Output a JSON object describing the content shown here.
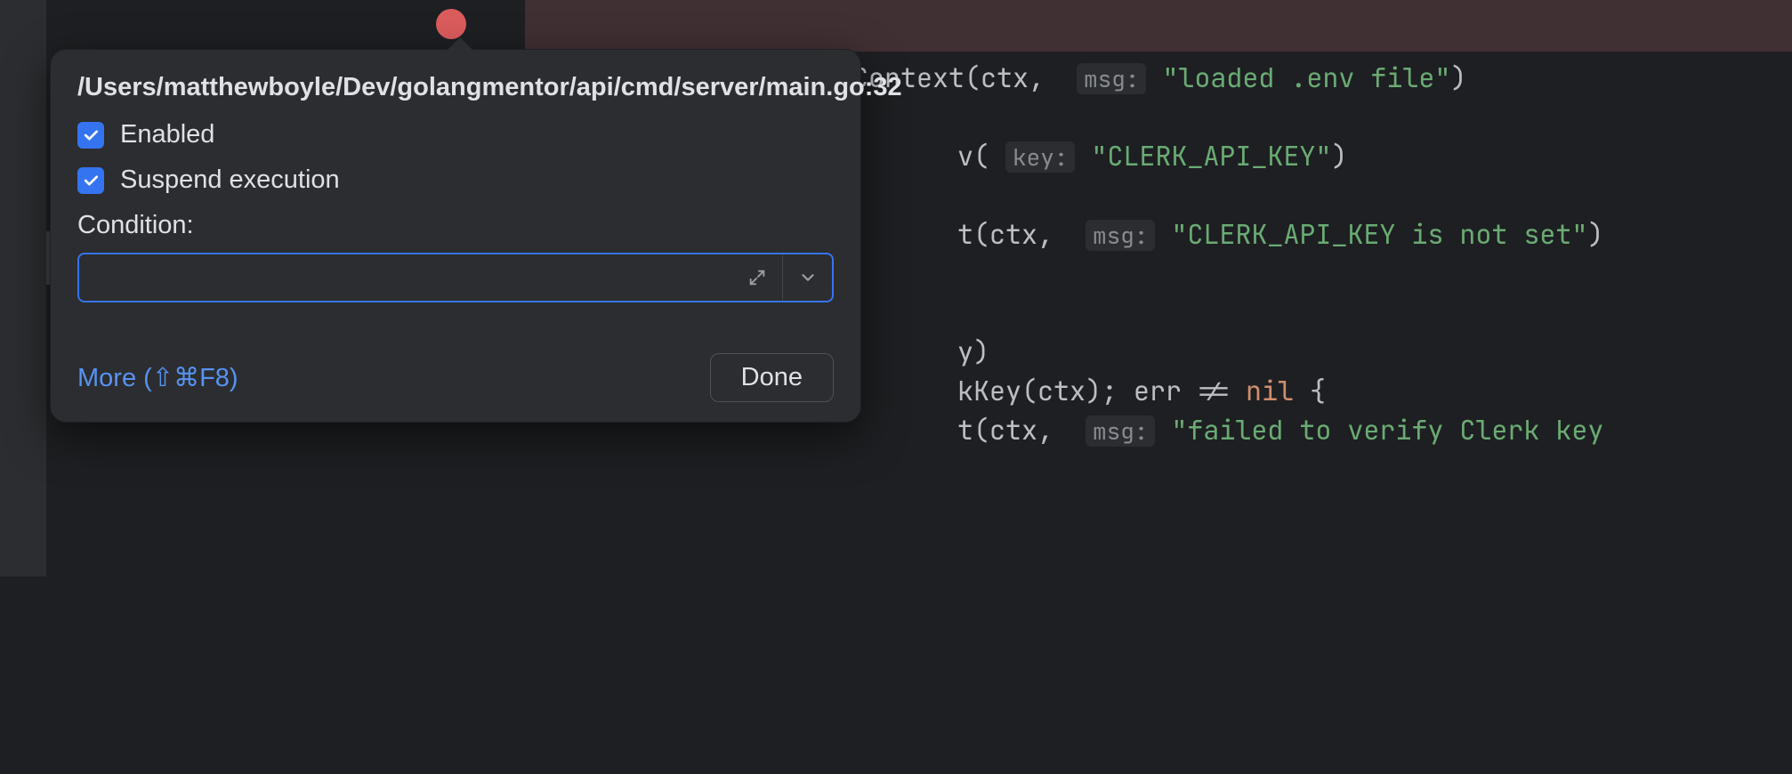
{
  "breakpoint": {
    "path": "/Users/matthewboyle/Dev/golangmentor/api/cmd/server/main.go:32",
    "enabled_label": "Enabled",
    "suspend_label": "Suspend execution",
    "condition_label": "Condition:",
    "condition_value": "",
    "more_label": "More (⇧⌘F8)",
    "done_label": "Done"
  },
  "code": {
    "l1_func": "slog.DebugContext",
    "l1_arg1": "ctx",
    "l1_hint": "msg:",
    "l1_str": "\"loaded .env file\"",
    "l2_tail": "v(",
    "l2_hint": "key:",
    "l2_str": "\"CLERK_API_KEY\"",
    "l3_tail": "t(ctx,",
    "l3_hint": "msg:",
    "l3_str": "\"CLERK_API_KEY is not set\"",
    "l4": "y)",
    "l5_a": "kKey(ctx); err != ",
    "l5_nil": "nil",
    "l5_c": " {",
    "l6_tail": "t(ctx,",
    "l6_hint": "msg:",
    "l6_str": "\"failed to verify Clerk key"
  }
}
